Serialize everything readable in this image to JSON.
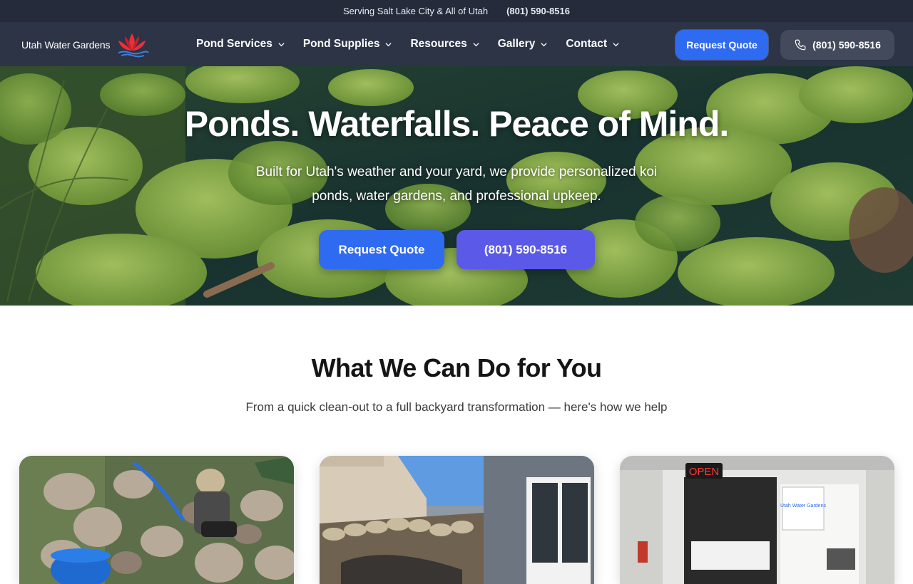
{
  "topbar": {
    "service_area": "Serving Salt Lake City & All of Utah",
    "phone": "(801) 590-8516"
  },
  "nav": {
    "logo_text": "Utah Water Gardens",
    "menu": [
      {
        "label": "Pond Services"
      },
      {
        "label": "Pond Supplies"
      },
      {
        "label": "Resources"
      },
      {
        "label": "Gallery"
      },
      {
        "label": "Contact"
      }
    ],
    "quote_label": "Request Quote",
    "phone_label": "(801) 590-8516"
  },
  "hero": {
    "title": "Ponds. Waterfalls. Peace of Mind.",
    "subtitle": "Built for Utah's weather and your yard, we provide personalized koi ponds, water gardens, and professional upkeep.",
    "quote_button": "Request Quote",
    "phone_button": "(801) 590-8516"
  },
  "services": {
    "title": "What We Can Do for You",
    "subtitle": "From a quick clean-out to a full backyard transformation — here's how we help",
    "cards": [
      {
        "image": "pond-cleaning-photo"
      },
      {
        "image": "pond-construction-photo"
      },
      {
        "image": "storefront-photo",
        "sign_text": "OPEN",
        "storefront_sign": "Utah Water Gardens"
      }
    ]
  },
  "colors": {
    "topbar_bg": "#252b3b",
    "nav_bg": "#2c3446",
    "primary": "#2f6bf0",
    "secondary": "#5b59e8",
    "logo_lotus": "#e8303a"
  }
}
